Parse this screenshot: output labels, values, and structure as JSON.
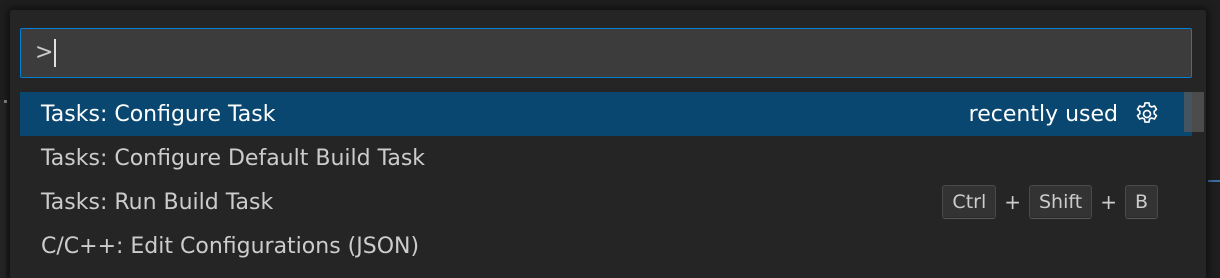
{
  "quick_open": {
    "input_value": ">",
    "items": [
      {
        "label": "Tasks: Configure Task",
        "detail": "recently used",
        "icon": "gear-icon",
        "selected": true,
        "keybinding": []
      },
      {
        "label": "Tasks: Configure Default Build Task",
        "detail": "",
        "selected": false,
        "keybinding": []
      },
      {
        "label": "Tasks: Run Build Task",
        "detail": "",
        "selected": false,
        "keybinding": [
          "Ctrl",
          "Shift",
          "B"
        ]
      },
      {
        "label": "C/C++: Edit Configurations (JSON)",
        "detail": "",
        "selected": false,
        "keybinding": []
      }
    ],
    "keybinding_separator": "+"
  },
  "colors": {
    "widget_background": "#252526",
    "input_background": "#3c3c3c",
    "focus_border": "#007fd4",
    "selection_background": "#094771",
    "foreground": "#cccccc"
  }
}
